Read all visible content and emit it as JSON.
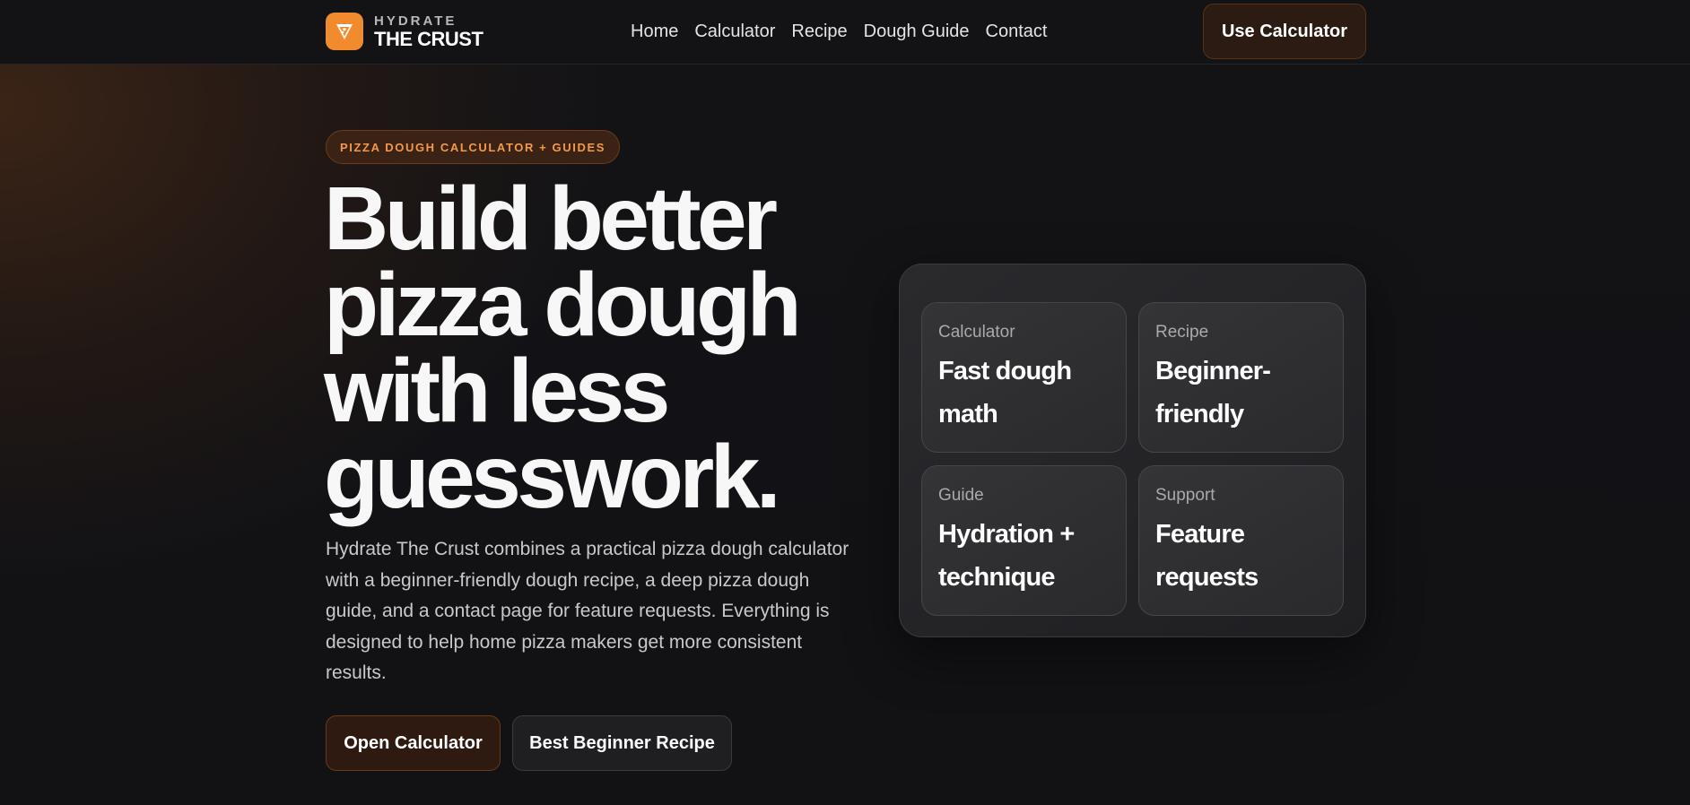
{
  "brand": {
    "name_top": "HYDRATE",
    "name_bottom": "THE CRUST",
    "logo_icon": "pizza-slice-icon",
    "accent_color": "#f28a2e"
  },
  "nav": {
    "links": [
      "Home",
      "Calculator",
      "Recipe",
      "Dough Guide",
      "Contact"
    ],
    "cta_label": "Use Calculator"
  },
  "hero": {
    "badge": "PIZZA DOUGH CALCULATOR + GUIDES",
    "title_lines": [
      "Build better",
      "pizza dough",
      "with less",
      "guesswork."
    ],
    "description": "Hydrate The Crust combines a practical pizza dough calculator with a beginner-friendly dough recipe, a deep pizza dough guide, and a contact page for feature requests. Everything is designed to help home pizza makers get more consistent results.",
    "primary_button": "Open Calculator",
    "secondary_button": "Best Beginner Recipe"
  },
  "features": [
    {
      "label": "Calculator",
      "title": "Fast dough math"
    },
    {
      "label": "Recipe",
      "title": "Beginner-friendly"
    },
    {
      "label": "Guide",
      "title": "Hydration + technique"
    },
    {
      "label": "Support",
      "title": "Feature requests"
    }
  ]
}
